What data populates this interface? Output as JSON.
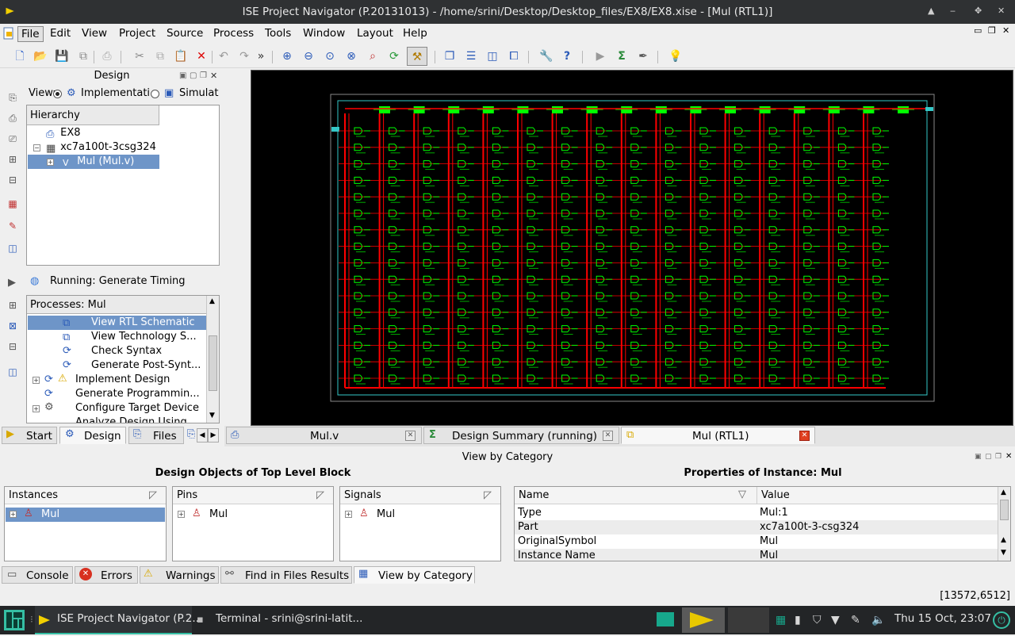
{
  "window": {
    "title": "ISE Project Navigator (P.20131013) - /home/srini/Desktop/Desktop_files/EX8/EX8.xise - [Mul (RTL1)]"
  },
  "menu": [
    "File",
    "Edit",
    "View",
    "Project",
    "Source",
    "Process",
    "Tools",
    "Window",
    "Layout",
    "Help"
  ],
  "design_panel": {
    "title": "Design",
    "view_label": "View:",
    "view_opt1": "Implementati",
    "view_opt2": "Simulat",
    "hierarchy_header": "Hierarchy",
    "tree": [
      "EX8",
      "xc7a100t-3csg324",
      "Mul (Mul.v)"
    ],
    "running": "Running: Generate Timing",
    "processes_header": "Processes: Mul",
    "processes": [
      "View RTL Schematic",
      "View Technology S...",
      "Check Syntax",
      "Generate Post-Synt...",
      "Implement Design",
      "Generate Programmin...",
      "Configure Target Device",
      "Analyze Design Using ..."
    ],
    "tabs": [
      "Start",
      "Design",
      "Files"
    ]
  },
  "editor_tabs": [
    {
      "label": "Mul.v"
    },
    {
      "label": "Design Summary (running)"
    },
    {
      "label": "Mul (RTL1)"
    }
  ],
  "bottom": {
    "title": "View by Category",
    "objects_title": "Design Objects of Top Level Block",
    "props_title": "Properties of Instance: Mul",
    "instances_header": "Instances",
    "pins_header": "Pins",
    "signals_header": "Signals",
    "instances_item": "Mul",
    "pins_item": "Mul",
    "signals_item": "Mul",
    "name_header": "Name",
    "value_header": "Value",
    "props": [
      {
        "name": "Type",
        "value": "Mul:1"
      },
      {
        "name": "Part",
        "value": "xc7a100t-3-csg324"
      },
      {
        "name": "OriginalSymbol",
        "value": "Mul"
      },
      {
        "name": "Instance Name",
        "value": "Mul"
      }
    ],
    "tabs": [
      "Console",
      "Errors",
      "Warnings",
      "Find in Files Results",
      "View by Category"
    ]
  },
  "status": {
    "coords": "[13572,6512]"
  },
  "taskbar": {
    "task1": "ISE Project Navigator (P.2...",
    "task2": "Terminal - srini@srini-latit...",
    "clock": "Thu 15 Oct, 23:07"
  },
  "colors": {
    "schematic_bg": "#000000",
    "wire": "#ff0000",
    "gate": "#00ff00",
    "selection": "#6e95c8"
  }
}
